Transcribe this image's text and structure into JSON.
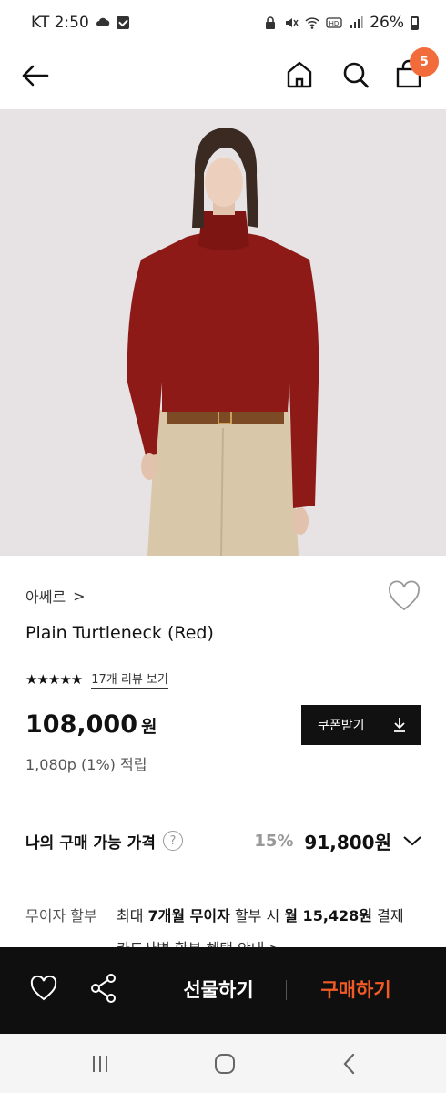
{
  "status_bar": {
    "carrier_time": "KT 2:50",
    "battery": "26%"
  },
  "nav": {
    "cart_count": "5",
    "icons": [
      "back-arrow-icon",
      "home-icon",
      "search-icon",
      "shopping-bag-icon"
    ]
  },
  "product": {
    "brand": "아쎄르",
    "brand_chevron": ">",
    "name": "Plain Turtleneck (Red)",
    "stars": "★★★★★",
    "rating_out_of_5": 5,
    "review_link": "17개 리뷰 보기",
    "price": "108,000",
    "price_unit": "원",
    "points": "1,080p (1%) 적립",
    "coupon_label": "쿠폰받기"
  },
  "member_price": {
    "label": "나의 구매 가능 가격",
    "help": "?",
    "discount": "15%",
    "price": "91,800원"
  },
  "installment": {
    "label": "무이자 할부",
    "text_prefix": "최대 ",
    "months": "7개월 무이자",
    "text_mid": " 할부 시 ",
    "monthly": "월 15,428원",
    "text_suffix": " 결제",
    "card_info": "카드사별 할부 혜택 안내 >"
  },
  "bottom_bar": {
    "gift_label": "선물하기",
    "buy_label": "구매하기"
  },
  "colors": {
    "accent": "#f25a26",
    "badge": "#f26b3a",
    "bar": "#0f0f0f",
    "sweater": "#8e1a17"
  }
}
